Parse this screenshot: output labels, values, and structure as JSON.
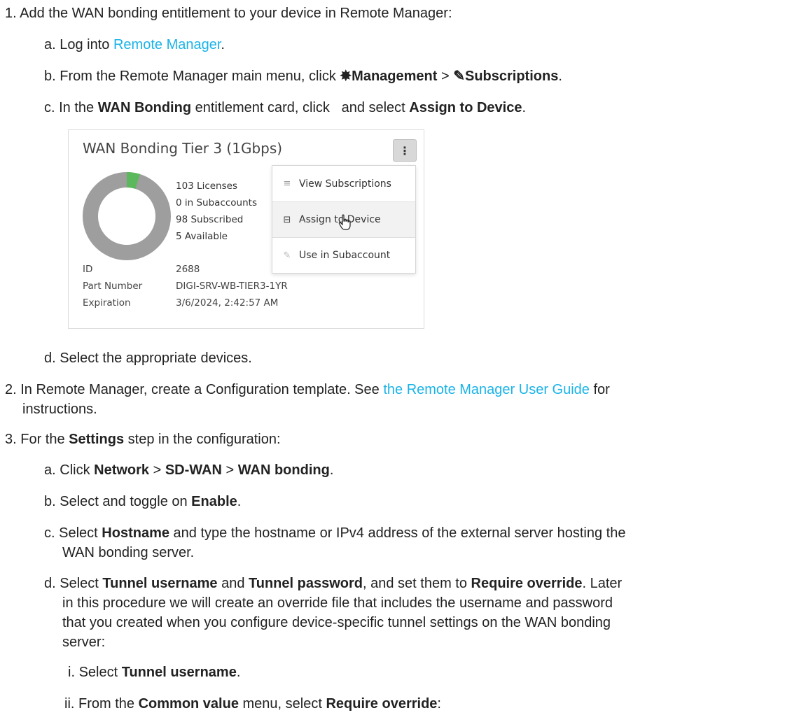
{
  "steps": {
    "s1": {
      "num": "1.",
      "text": "Add the WAN bonding entitlement to your device in Remote Manager:"
    },
    "s1a": {
      "letter": "a.",
      "pre": "Log into ",
      "link": "Remote Manager",
      "post": "."
    },
    "s1b": {
      "letter": "b.",
      "pre": "From the Remote Manager main menu, click ",
      "icon1": "✸",
      "bold1": "Management",
      "sep": " > ",
      "icon2": "✎",
      "bold2": "Subscriptions",
      "post": "."
    },
    "s1c": {
      "letter": "c.",
      "pre": "In the ",
      "bold1": "WAN Bonding",
      "mid": " entitlement card, click   and select ",
      "bold2": "Assign to Device",
      "post": "."
    },
    "s1d": {
      "letter": "d.",
      "text": "Select the appropriate devices."
    },
    "s2": {
      "num": "2.",
      "pre": "In Remote Manager, create a Configuration template. See ",
      "link": "the Remote Manager User Guide",
      "post": " for",
      "line2": "instructions."
    },
    "s3": {
      "num": "3.",
      "pre": "For the ",
      "bold": "Settings",
      "post": " step in the configuration:"
    },
    "s3a": {
      "letter": "a.",
      "pre": "Click ",
      "b1": "Network",
      "sep1": " > ",
      "b2": "SD-WAN",
      "sep2": " > ",
      "b3": "WAN bonding",
      "post": "."
    },
    "s3b": {
      "letter": "b.",
      "pre": "Select and toggle on ",
      "bold": "Enable",
      "post": "."
    },
    "s3c": {
      "letter": "c.",
      "pre": "Select ",
      "bold": "Hostname",
      "post": " and type the hostname or IPv4 address of the external server hosting the",
      "line2": "WAN bonding server."
    },
    "s3d": {
      "letter": "d.",
      "pre": "Select ",
      "b1": "Tunnel username",
      "mid1": " and ",
      "b2": "Tunnel password",
      "mid2": ", and set them to ",
      "b3": "Require override",
      "post": ". Later",
      "line2": "in this procedure we will create an override file that includes the username and password",
      "line3": "that you created when you configure device-specific tunnel settings on the WAN bonding",
      "line4": "server:"
    },
    "s3di": {
      "roman": "i.",
      "pre": "Select ",
      "bold": "Tunnel username",
      "post": "."
    },
    "s3dii": {
      "roman": "ii.",
      "pre": "From the ",
      "b1": "Common value",
      "mid": " menu, select ",
      "b2": "Require override",
      "post": ":"
    }
  },
  "card": {
    "title": "WAN Bonding Tier 3 (1Gbps)",
    "kebab": "⋮",
    "stats": [
      "103 Licenses",
      "0 in Subaccounts",
      "98 Subscribed",
      "5 Available"
    ],
    "meta": [
      {
        "key": "ID",
        "value": "2688"
      },
      {
        "key": "Part Number",
        "value": "DIGI-SRV-WB-TIER3-1YR"
      },
      {
        "key": "Expiration",
        "value": "3/6/2024, 2:42:57 AM"
      }
    ],
    "menu": [
      {
        "icon": "≡",
        "label": "View Subscriptions"
      },
      {
        "icon": "⊟",
        "label": "Assign to Device"
      },
      {
        "icon": "✎",
        "label": "Use in Subaccount"
      }
    ],
    "donut": {
      "total": 103,
      "subscribed": 98,
      "available": 5,
      "color_used": "#9e9e9e",
      "color_available": "#5cb85c"
    }
  },
  "colors": {
    "link": "#1ab3e8",
    "text": "#222222"
  }
}
